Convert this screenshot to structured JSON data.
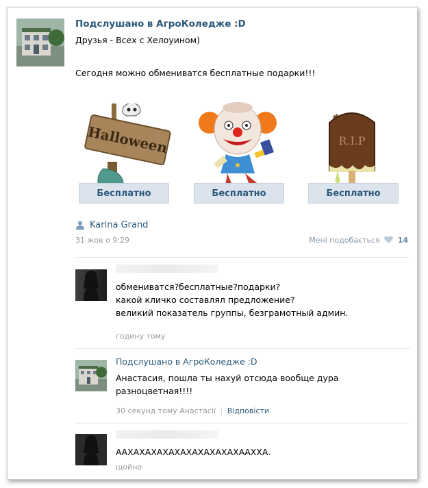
{
  "post": {
    "group_name": "Подслушано в АгроКоледже :D",
    "status_line": "Друзья - Всех с Хелоуином)",
    "body": "Сегодня можно обмениватся бесплатные подарки!!!"
  },
  "gifts": [
    {
      "name": "halloween-sign",
      "sign_text": "Halloween",
      "button": "Бесплатно"
    },
    {
      "name": "clown",
      "button": "Бесплатно"
    },
    {
      "name": "tombstone-icecream",
      "sign_text": "R.I.P",
      "button": "Бесплатно"
    }
  ],
  "meta": {
    "author": "Karina Grand",
    "date": "31 жов о 9:29",
    "likes_label": "Мені подобається",
    "likes_count": "14"
  },
  "comments": [
    {
      "lines": [
        "обмениватся?бесплатные?подарки?",
        "какой кличко составлял предложение?",
        "великий показатель группы, безграмотный админ."
      ],
      "time": "годину тому"
    },
    {
      "author": "Подслушано в АгроКоледже :D",
      "lines": [
        "Анастасия, пошла ты нахуй отсюда вообще дура",
        "разноцветная!!!!"
      ],
      "time": "30 секунд тому Анастасії",
      "reply": "Відповісти"
    },
    {
      "lines": [
        "ААХАХАХАХАХАХАХАХАХАХААХХА."
      ],
      "time": "щойно"
    }
  ],
  "colors": {
    "link": "#2b587a",
    "button_bg": "#dbe3ec",
    "meta": "#999999"
  }
}
